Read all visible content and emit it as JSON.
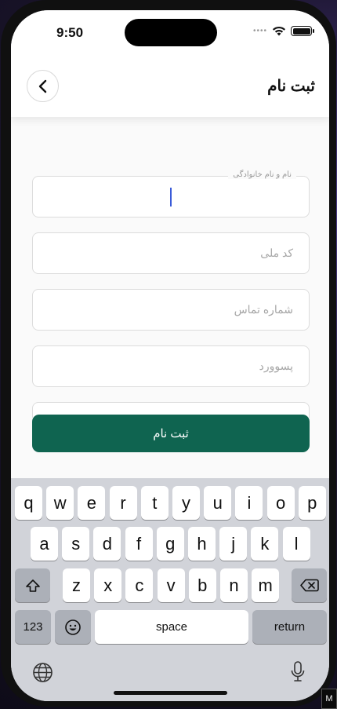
{
  "status": {
    "time": "9:50"
  },
  "header": {
    "title": "ثبت نام"
  },
  "form": {
    "fields": [
      {
        "label": "نام و نام خانوادگی",
        "value": ""
      },
      {
        "placeholder": "کد ملی"
      },
      {
        "placeholder": "شماره تماس"
      },
      {
        "placeholder": "پسوورد"
      }
    ],
    "submit_label": "ثبت نام"
  },
  "keyboard": {
    "row1": [
      "q",
      "w",
      "e",
      "r",
      "t",
      "y",
      "u",
      "i",
      "o",
      "p"
    ],
    "row2": [
      "a",
      "s",
      "d",
      "f",
      "g",
      "h",
      "j",
      "k",
      "l"
    ],
    "row3": [
      "z",
      "x",
      "c",
      "v",
      "b",
      "n",
      "m"
    ],
    "numbers_label": "123",
    "space_label": "space",
    "return_label": "return"
  },
  "corner_label": "M"
}
